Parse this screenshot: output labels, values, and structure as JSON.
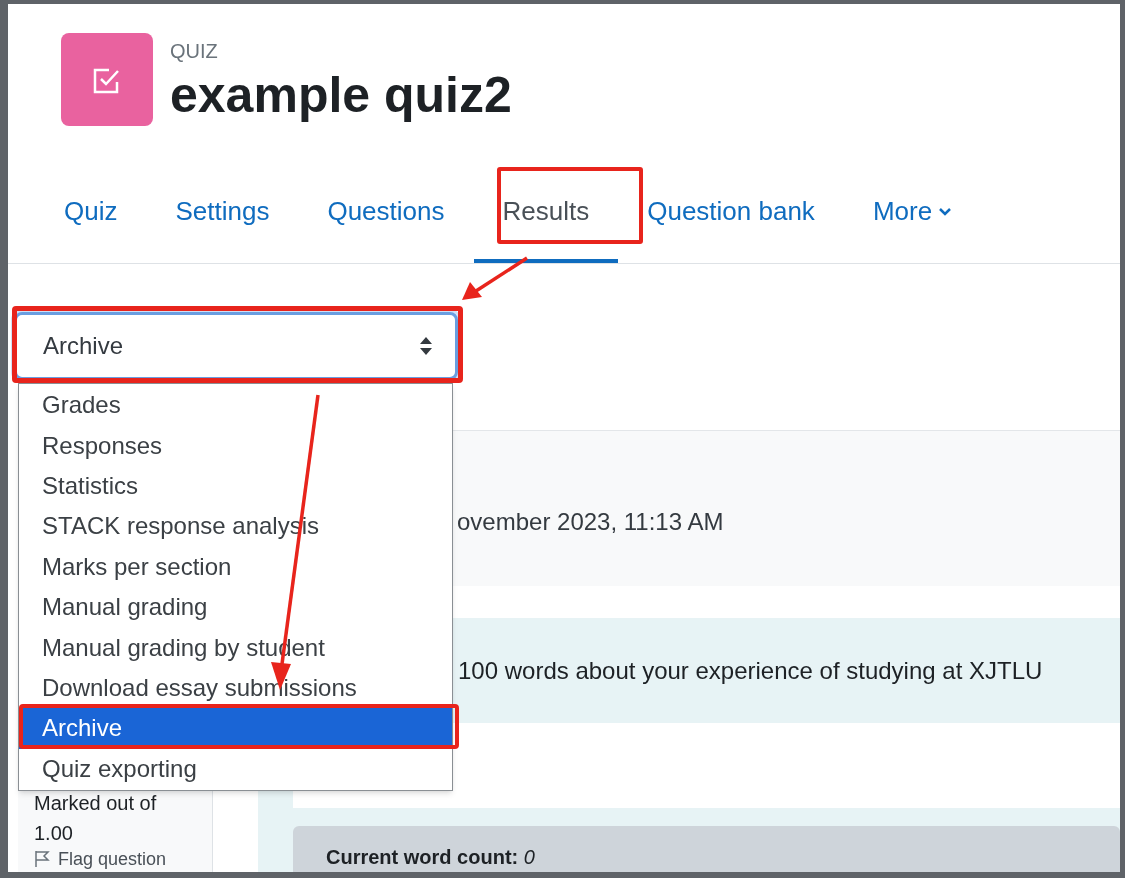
{
  "module": {
    "type_label": "QUIZ",
    "title": "example quiz2"
  },
  "tabs": [
    {
      "label": "Quiz",
      "selected": false,
      "kind": "link"
    },
    {
      "label": "Settings",
      "selected": false,
      "kind": "link"
    },
    {
      "label": "Questions",
      "selected": false,
      "kind": "link"
    },
    {
      "label": "Results",
      "selected": true,
      "kind": "link"
    },
    {
      "label": "Question bank",
      "selected": false,
      "kind": "link"
    },
    {
      "label": "More",
      "selected": false,
      "kind": "menu"
    }
  ],
  "report_select": {
    "value": "Archive",
    "expanded": true,
    "options": [
      {
        "label": "Grades",
        "selected": false
      },
      {
        "label": "Responses",
        "selected": false
      },
      {
        "label": "Statistics",
        "selected": false
      },
      {
        "label": "STACK response analysis",
        "selected": false
      },
      {
        "label": "Marks per section",
        "selected": false
      },
      {
        "label": "Manual grading",
        "selected": false
      },
      {
        "label": "Manual grading by student",
        "selected": false
      },
      {
        "label": "Download essay submissions",
        "selected": false
      },
      {
        "label": "Archive",
        "selected": true
      },
      {
        "label": "Quiz exporting",
        "selected": false
      }
    ]
  },
  "attempt_info": {
    "text": "ovember 2023, 11:13 AM"
  },
  "question_info": {
    "marked_label": "Marked out of",
    "marked_value": "1.00",
    "flag": "Flag question"
  },
  "question_text": "100 words about your experience of studying at XJTLU",
  "word_count": {
    "label": "Current word count:",
    "value": "0"
  }
}
